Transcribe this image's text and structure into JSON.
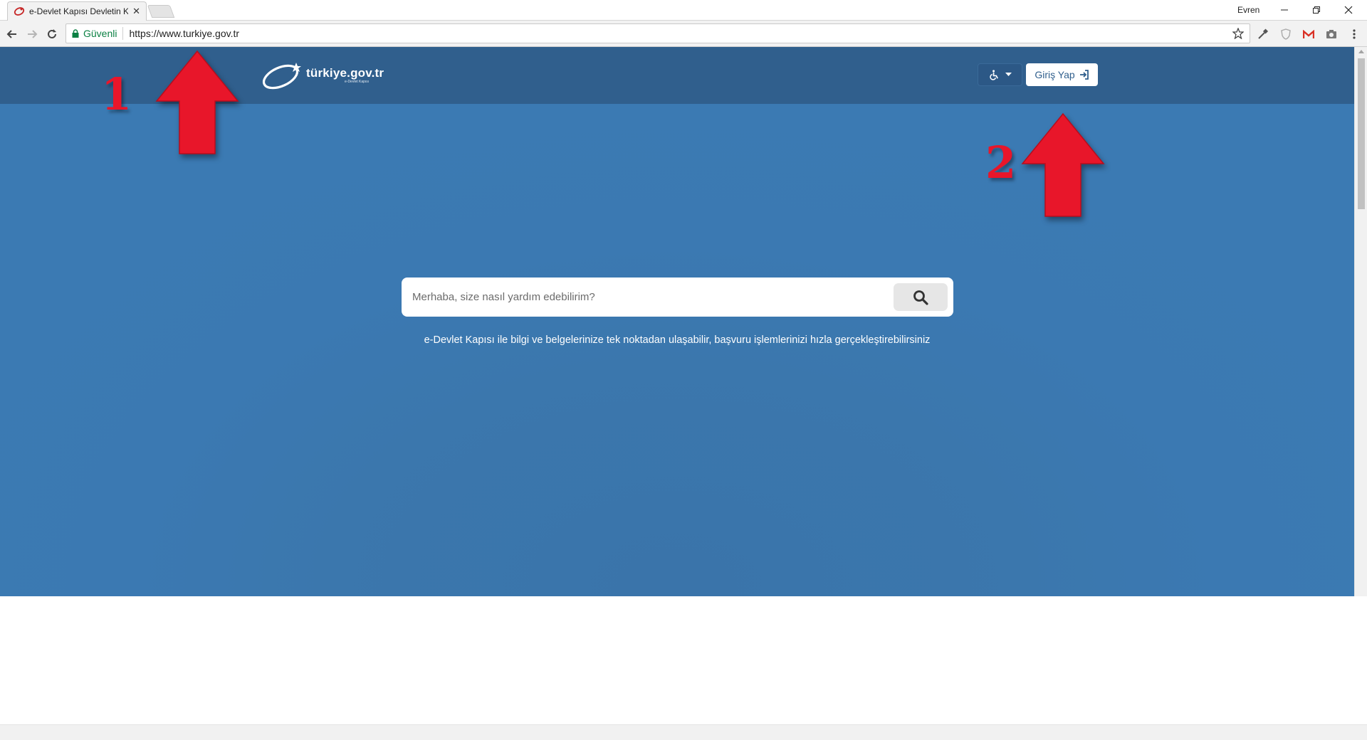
{
  "browser": {
    "tab_title": "e-Devlet Kapısı Devletin Kı",
    "profile_name": "Evren",
    "secure_label": "Güvenli",
    "url": "https://www.turkiye.gov.tr"
  },
  "site": {
    "logo_text": "türkiye.gov.tr",
    "logo_sub": "e-Devlet Kapısı",
    "login_label": "Giriş Yap",
    "search_placeholder": "Merhaba, size nasıl yardım edebilirim?",
    "tagline": "e-Devlet Kapısı ile bilgi ve belgelerinize tek noktadan ulaşabilir, başvuru işlemlerinizi hızla gerçekleştirebilirsiniz"
  },
  "annotations": {
    "first": "1",
    "second": "2"
  },
  "colors": {
    "header": "#305f8d",
    "page_blue": "#3b79b2",
    "annotation_red": "#e8162a"
  },
  "icons": [
    "e-devlet-favicon",
    "back-arrow-icon",
    "forward-arrow-icon",
    "reload-icon",
    "lock-icon",
    "star-icon",
    "eyedropper-icon",
    "shield-icon",
    "gmail-icon",
    "camera-icon",
    "menu-icon",
    "wheelchair-icon",
    "login-icon",
    "search-icon"
  ]
}
